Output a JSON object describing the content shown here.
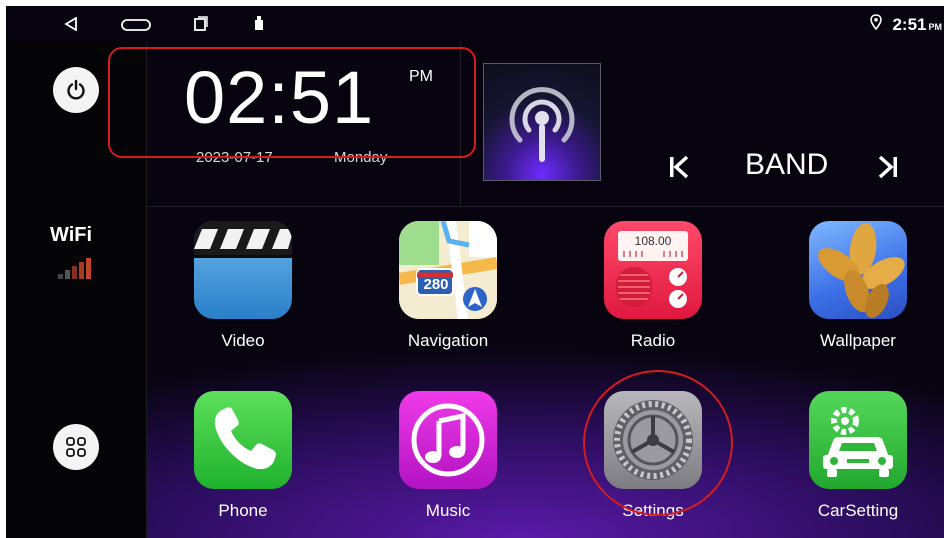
{
  "status_bar": {
    "back_icon": "back-triangle-icon",
    "home_icon": "home-pill-icon",
    "recents_icon": "recents-square-icon",
    "usb_icon": "usb-icon",
    "location_icon": "location-pin-icon",
    "time": "2:51",
    "ampm": "PM"
  },
  "sidebar": {
    "power_icon": "power-icon",
    "wifi_label": "WiFi",
    "wifi_signal_icon": "signal-bars-icon",
    "apps_icon": "apps-grid-icon"
  },
  "clock": {
    "time": "02:51",
    "ampm": "PM",
    "date": "2023-07-17",
    "day": "Monday"
  },
  "media": {
    "art_icon": "podcast-broadcast-icon",
    "prev_icon": "skip-previous-icon",
    "band_label": "BAND",
    "next_icon": "skip-next-icon"
  },
  "apps": [
    {
      "label": "Video",
      "icon": "video-clapper-icon"
    },
    {
      "label": "Navigation",
      "icon": "map-navigation-icon"
    },
    {
      "label": "Radio",
      "icon": "radio-icon"
    },
    {
      "label": "Wallpaper",
      "icon": "leaves-wallpaper-icon"
    },
    {
      "label": "Phone",
      "icon": "phone-handset-icon"
    },
    {
      "label": "Music",
      "icon": "music-note-icon"
    },
    {
      "label": "Settings",
      "icon": "gear-icon"
    },
    {
      "label": "CarSetting",
      "icon": "car-gear-icon"
    }
  ],
  "radio_icon_freq": "108.00",
  "nav_icon_road": "280",
  "colors": {
    "annotation_red": "#d41c1c",
    "phone_green": "#2fc83a",
    "music_magenta": "#d21bd0",
    "radio_red": "#f0284a",
    "carsetting_green": "#34c43c"
  }
}
